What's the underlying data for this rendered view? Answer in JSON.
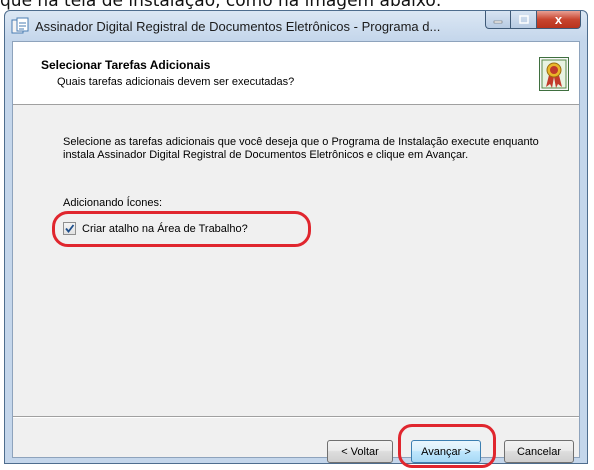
{
  "top_strip": {
    "text": "que na tela de instalação, como na imagem abaixo:"
  },
  "window": {
    "title": "Assinador Digital Registral de Documentos Eletrônicos - Programa d...",
    "min_icon": "minimize-icon",
    "max_icon": "maximize-icon",
    "close_icon": "close-icon",
    "close_glyph": "x"
  },
  "header": {
    "title": "Selecionar Tarefas Adicionais",
    "subtitle": "Quais tarefas adicionais devem ser executadas?"
  },
  "body": {
    "text": "Selecione as tarefas adicionais que você deseja que o Programa de Instalação execute enquanto instala Assinador Digital Registral de Documentos Eletrônicos e clique em Avançar.",
    "group_label": "Adicionando Ícones:",
    "checkbox_label": "Criar atalho na Área de Trabalho?",
    "checkbox_checked": true
  },
  "buttons": {
    "back": "< Voltar",
    "next": "Avançar >",
    "cancel": "Cancelar"
  },
  "colors": {
    "highlight": "#e0262e",
    "titlebar": "#c4d6eb"
  }
}
